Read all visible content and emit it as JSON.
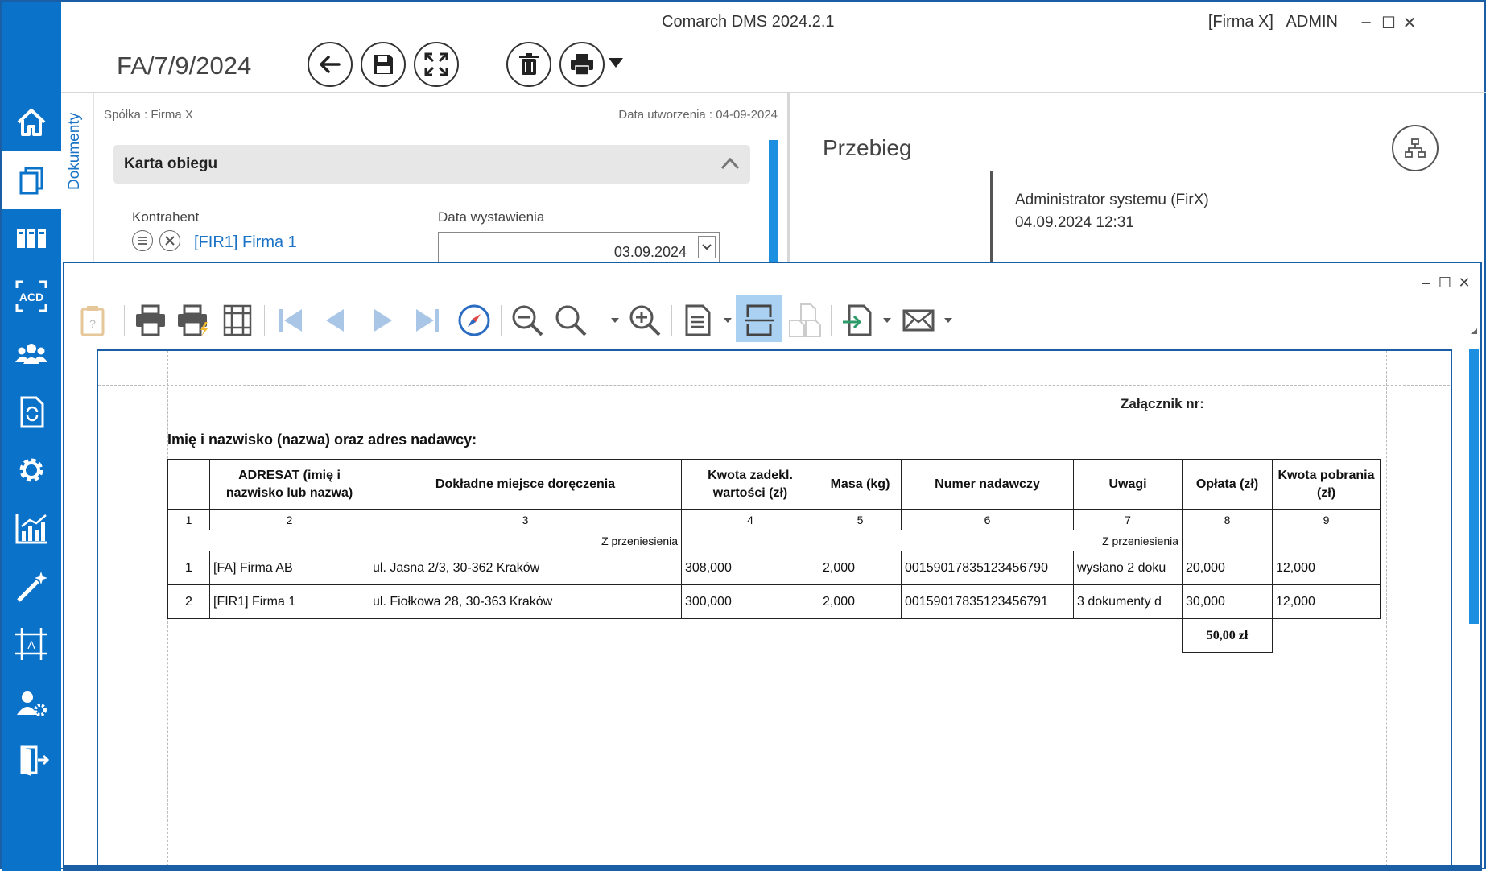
{
  "window": {
    "title": "Comarch DMS 2024.2.1",
    "firm": "[Firma X]",
    "user": "ADMIN",
    "controls": [
      "–",
      "☐",
      "✕"
    ]
  },
  "sidebar": {
    "items": [
      {
        "name": "home"
      },
      {
        "name": "documents",
        "active": true
      },
      {
        "name": "repository"
      },
      {
        "name": "acd"
      },
      {
        "name": "contacts"
      },
      {
        "name": "workflow"
      },
      {
        "name": "settings"
      },
      {
        "name": "reports"
      },
      {
        "name": "wizard"
      },
      {
        "name": "designer"
      },
      {
        "name": "admin"
      },
      {
        "name": "logout"
      }
    ]
  },
  "document": {
    "number": "FA/7/9/2024",
    "tab_label": "Dokumenty",
    "company": "Spółka : Firma X",
    "created": "Data utworzenia : 04-09-2024",
    "section_title": "Karta obiegu",
    "contractor_label": "Kontrahent",
    "contractor_value": "[FIR1] Firma 1",
    "issue_date_label": "Data wystawienia",
    "issue_date_value": "03.09.2024"
  },
  "flow": {
    "title": "Przebieg",
    "person": "Administrator systemu (FirX)",
    "datetime": "04.09.2024 12:31"
  },
  "preview": {
    "controls": [
      "–",
      "☐",
      "✕"
    ],
    "attachment_label": "Załącznik nr:",
    "sender_label": "Imię i nazwisko (nazwa) oraz adres nadawcy:",
    "columns": [
      "",
      "ADRESAT (imię i nazwisko lub nazwa)",
      "Dokładne miejsce doręczenia",
      "Kwota zadekl. wartości (zł)",
      "Masa (kg)",
      "Numer nadawczy",
      "Uwagi",
      "Opłata (zł)",
      "Kwota pobrania (zł)"
    ],
    "column_numbers": [
      "1",
      "2",
      "3",
      "4",
      "5",
      "6",
      "7",
      "8",
      "9"
    ],
    "carry_over_label_1": "Z przeniesienia",
    "carry_over_label_2": "Z przeniesienia",
    "rows": [
      {
        "lp": "1",
        "addressee": "[FA] Firma AB",
        "address": "ul. Jasna 2/3, 30-362 Kraków",
        "value": "308,000",
        "mass": "2,000",
        "tracking": "00159017835123456790",
        "notes": "wysłano 2 doku",
        "fee": "20,000",
        "cod": "12,000"
      },
      {
        "lp": "2",
        "addressee": "[FIR1] Firma 1",
        "address": "ul. Fiołkowa 28, 30-363 Kraków",
        "value": "300,000",
        "mass": "2,000",
        "tracking": "00159017835123456791",
        "notes": "3 dokumenty d",
        "fee": "30,000",
        "cod": "12,000"
      }
    ],
    "total_fee": "50,00 zł"
  }
}
